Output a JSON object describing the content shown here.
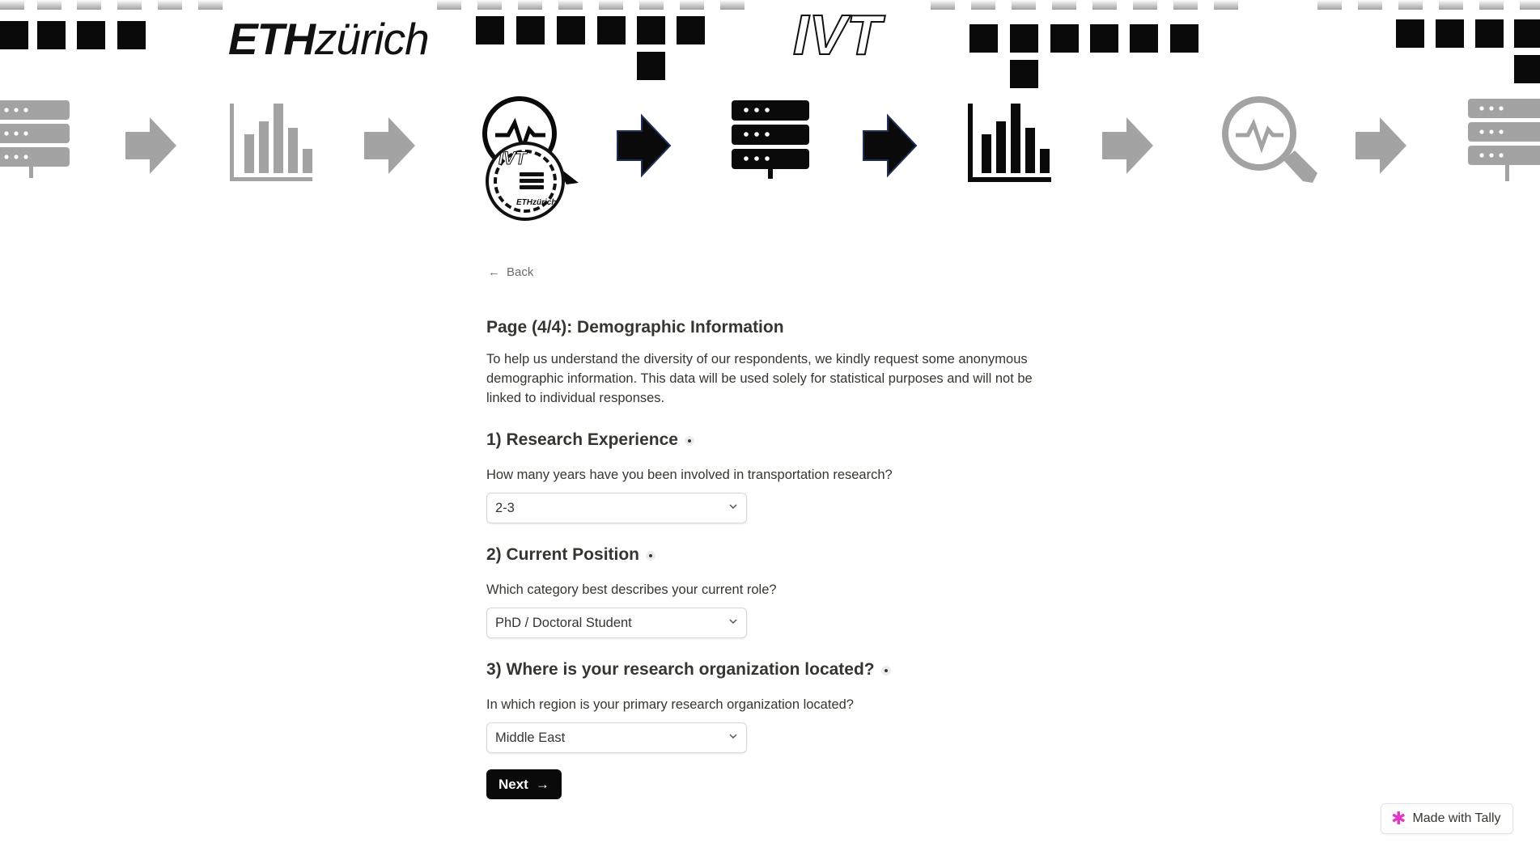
{
  "header": {
    "logo_eth_bold": "ETH",
    "logo_eth_light": "zürich",
    "logo_ivt": "IVT",
    "avatar_ivt": "IVT",
    "avatar_eth": "ETHzürich"
  },
  "nav": {
    "back_label": "Back"
  },
  "page": {
    "title": "Page (4/4): Demographic Information",
    "intro": "To help us understand the diversity of our respondents, we kindly request some anonymous demographic information. This data will be used solely for statistical purposes and will not be linked to individual responses."
  },
  "questions": [
    {
      "title": "1) Research Experience",
      "description": "How many years have you been involved in transportation research?",
      "selected": "2-3"
    },
    {
      "title": "2) Current Position",
      "description": "Which category best describes your current role?",
      "selected": "PhD / Doctoral Student"
    },
    {
      "title": "3) Where is your research organization located?",
      "description": "In which region is your primary research organization located?",
      "selected": "Middle East"
    }
  ],
  "actions": {
    "next_label": "Next"
  },
  "footer": {
    "tally_label": "Made with Tally"
  },
  "colors": {
    "accent_button": "#0a0a0a",
    "tally_star": "#e038c6",
    "icon_gray": "#a3a3a3"
  },
  "icons": [
    "server-icon",
    "bar-chart-icon",
    "arrow-right-icon",
    "search-pulse-icon",
    "chevron-down-icon",
    "arrow-left-icon"
  ]
}
